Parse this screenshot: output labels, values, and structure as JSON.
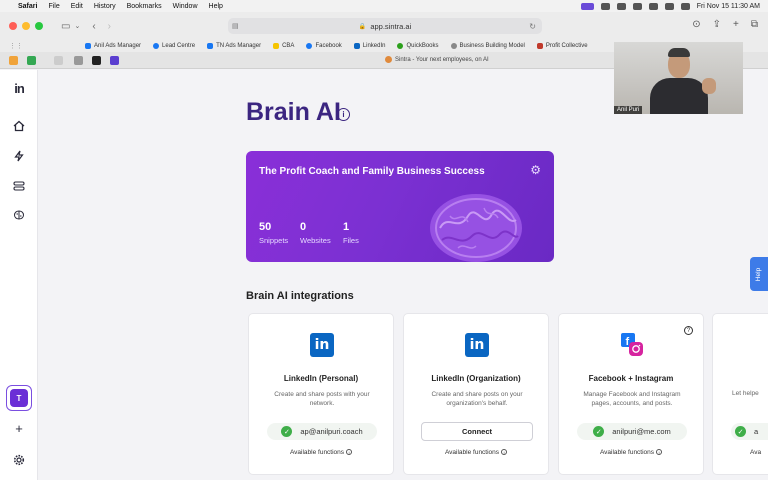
{
  "menubar": {
    "app": "Safari",
    "items": [
      "File",
      "Edit",
      "History",
      "Bookmarks",
      "Window",
      "Help"
    ],
    "clock": "Fri Nov 15  11:30 AM"
  },
  "browser": {
    "url": "app.sintra.ai",
    "tab_title": "Sintra - Your next employees, on AI",
    "bookmarks": [
      {
        "label": "Anil Ads Manager",
        "color": "#1877f2"
      },
      {
        "label": "Lead Centre",
        "color": "#1877f2"
      },
      {
        "label": "TN Ads Manager",
        "color": "#1877f2"
      },
      {
        "label": "CBA",
        "color": "#f5c400"
      },
      {
        "label": "Facebook",
        "color": "#1877f2"
      },
      {
        "label": "LinkedIn",
        "color": "#0a66c2"
      },
      {
        "label": "QuickBooks",
        "color": "#2ca01c"
      },
      {
        "label": "Business Building Model",
        "color": "#888888"
      },
      {
        "label": "Profit Collective",
        "color": "#c0392b"
      }
    ]
  },
  "sidebar": {
    "logo": "in",
    "avatar_letter": "T",
    "add_label": "+"
  },
  "main": {
    "title": "Brain AI",
    "card": {
      "title": "The Profit Coach and Family Business Success",
      "stats": [
        {
          "value": "50",
          "label": "Snippets"
        },
        {
          "value": "0",
          "label": "Websites"
        },
        {
          "value": "1",
          "label": "Files"
        }
      ]
    },
    "integrations_title": "Brain AI integrations",
    "integrations": [
      {
        "name": "LinkedIn (Personal)",
        "description": "Create and share posts with your network.",
        "account": "ap@anilpuri.coach",
        "footer": "Available functions"
      },
      {
        "name": "LinkedIn (Organization)",
        "description": "Create and share posts on your organization's behalf.",
        "action": "Connect",
        "footer": "Available functions"
      },
      {
        "name": "Facebook + Instagram",
        "description": "Manage Facebook and Instagram pages, accounts, and posts.",
        "account": "anilpuri@me.com",
        "footer": "Available functions"
      }
    ],
    "partial_card": {
      "desc_fragment": "Let helpe",
      "account_fragment": "a",
      "footer_fragment": "Ava"
    },
    "help_label": "Help"
  },
  "webcam": {
    "name": "Anil Puri"
  },
  "colors": {
    "brand_purple": "#3b2580",
    "card_purple": "#7b30d2",
    "linkedin_blue": "#0a66c2",
    "success_green": "#3fae49",
    "help_blue": "#3d7be8"
  }
}
